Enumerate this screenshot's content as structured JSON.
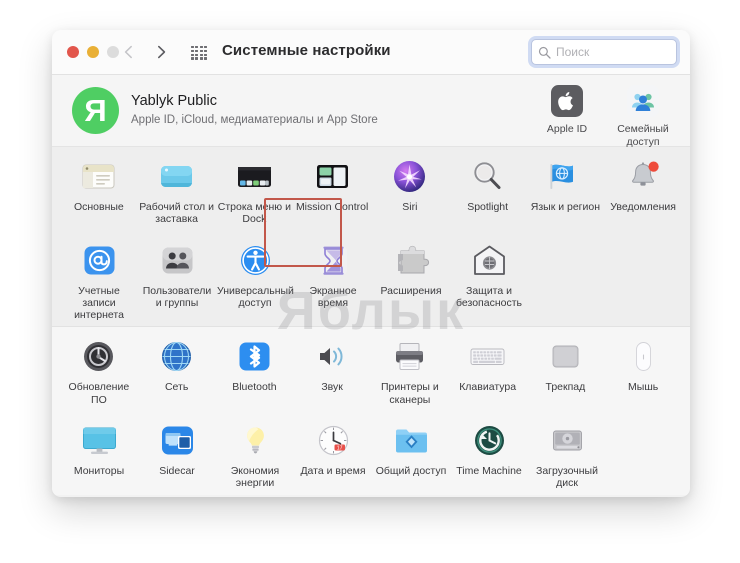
{
  "window": {
    "title": "Системные настройки",
    "traffic_lights": [
      {
        "name": "close",
        "color": "#e2564c"
      },
      {
        "name": "minimize",
        "color": "#e9b036"
      },
      {
        "name": "zoom",
        "color": "#dcdcdc"
      }
    ],
    "nav": {
      "back": "‹",
      "forward": "›",
      "grid_icon": "grid-icon"
    }
  },
  "search": {
    "placeholder": "Поиск",
    "value": "",
    "icon": "search-icon",
    "focus_ring_color": "#82a0e4"
  },
  "account": {
    "avatar_letter": "Я",
    "avatar_color": "#4fce63",
    "name": "Yablyk Public",
    "subtitle": "Apple ID, iCloud, медиаматериалы и App Store",
    "tiles": [
      {
        "id": "apple-id",
        "label": "Apple ID",
        "icon": "apple-logo-icon"
      },
      {
        "id": "family-sharing",
        "label": "Семейный доступ",
        "icon": "family-sharing-icon"
      }
    ]
  },
  "highlight": {
    "target": "Строка меню и Dock",
    "color": "#c2574a"
  },
  "watermark": {
    "text": "Яблык",
    "color": "#78787d"
  },
  "panes": [
    {
      "id": "pane-personal",
      "shaded": true,
      "rows": [
        [
          {
            "id": "general",
            "label": "Основные",
            "icon": "general-icon"
          },
          {
            "id": "desktop-screensaver",
            "label": "Рабочий стол и заставка",
            "icon": "desktop-icon"
          },
          {
            "id": "dock-menubar",
            "label": "Строка меню и Dock",
            "icon": "dock-icon"
          },
          {
            "id": "mission-control",
            "label": "Mission Control",
            "icon": "mission-control-icon"
          },
          {
            "id": "siri",
            "label": "Siri",
            "icon": "siri-icon"
          },
          {
            "id": "spotlight",
            "label": "Spotlight",
            "icon": "spotlight-icon"
          },
          {
            "id": "language-region",
            "label": "Язык и регион",
            "icon": "language-region-icon"
          },
          {
            "id": "notifications",
            "label": "Уведомления",
            "icon": "notifications-icon"
          }
        ],
        [
          {
            "id": "internet-accounts",
            "label": "Учетные записи интернета",
            "icon": "internet-accounts-icon"
          },
          {
            "id": "users-groups",
            "label": "Пользователи и группы",
            "icon": "users-groups-icon"
          },
          {
            "id": "accessibility",
            "label": "Универсальный доступ",
            "icon": "accessibility-icon"
          },
          {
            "id": "screen-time",
            "label": "Экранное время",
            "icon": "screen-time-icon"
          },
          {
            "id": "extensions",
            "label": "Расширения",
            "icon": "extensions-icon"
          },
          {
            "id": "security-privacy",
            "label": "Защита и безопасность",
            "icon": "security-icon"
          }
        ]
      ]
    },
    {
      "id": "pane-hardware",
      "shaded": false,
      "rows": [
        [
          {
            "id": "software-update",
            "label": "Обновление ПО",
            "icon": "software-update-icon"
          },
          {
            "id": "network",
            "label": "Сеть",
            "icon": "network-icon"
          },
          {
            "id": "bluetooth",
            "label": "Bluetooth",
            "icon": "bluetooth-icon"
          },
          {
            "id": "sound",
            "label": "Звук",
            "icon": "sound-icon"
          },
          {
            "id": "printers-scanners",
            "label": "Принтеры и сканеры",
            "icon": "printer-icon"
          },
          {
            "id": "keyboard",
            "label": "Клавиатура",
            "icon": "keyboard-icon"
          },
          {
            "id": "trackpad",
            "label": "Трекпад",
            "icon": "trackpad-icon"
          },
          {
            "id": "mouse",
            "label": "Мышь",
            "icon": "mouse-icon"
          }
        ],
        [
          {
            "id": "displays",
            "label": "Мониторы",
            "icon": "display-icon"
          },
          {
            "id": "sidecar",
            "label": "Sidecar",
            "icon": "sidecar-icon"
          },
          {
            "id": "energy-saver",
            "label": "Экономия энергии",
            "icon": "lightbulb-icon"
          },
          {
            "id": "date-time",
            "label": "Дата и время",
            "icon": "clock-icon"
          },
          {
            "id": "sharing",
            "label": "Общий доступ",
            "icon": "sharing-folder-icon"
          },
          {
            "id": "time-machine",
            "label": "Time Machine",
            "icon": "time-machine-icon"
          },
          {
            "id": "startup-disk",
            "label": "Загрузочный диск",
            "icon": "hard-disk-icon"
          }
        ]
      ]
    }
  ]
}
